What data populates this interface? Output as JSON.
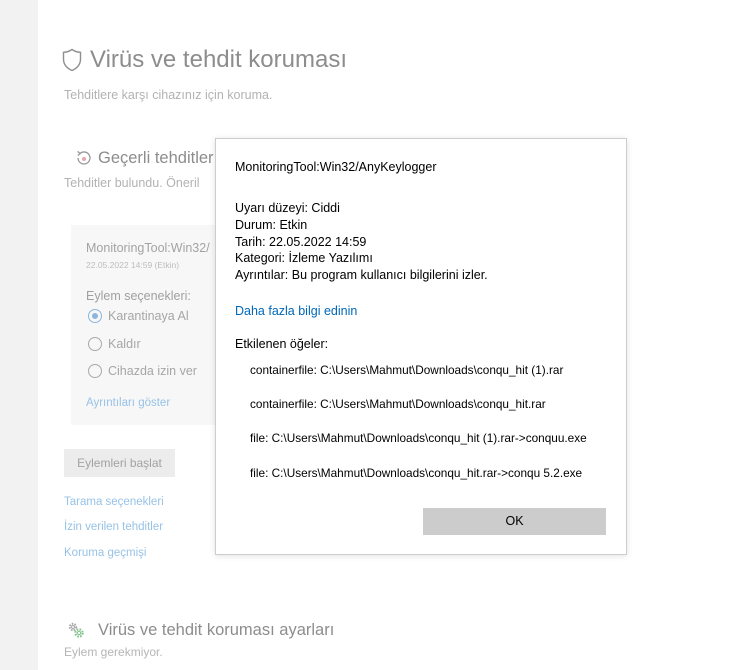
{
  "header": {
    "icon": "shield-icon",
    "title": "Virüs ve tehdit koruması",
    "subtitle": "Tehditlere karşı cihazınız için koruma."
  },
  "current_threats": {
    "icon": "threat-refresh-icon",
    "title": "Geçerli tehditler",
    "subtitle": "Tehditler bulundu. Öneril",
    "threat": {
      "name": "MonitoringTool:Win32/",
      "date": "22.05.2022 14:59 (Etkin)",
      "actions_label": "Eylem seçenekleri:",
      "options": [
        {
          "label": "Karantinaya Al",
          "selected": true
        },
        {
          "label": "Kaldır",
          "selected": false
        },
        {
          "label": "Cihazda izin ver",
          "selected": false
        }
      ],
      "details_link": "Ayrıntıları göster"
    },
    "start_button": "Eylemleri başlat",
    "links": [
      "Tarama seçenekleri",
      "İzin verilen tehditler",
      "Koruma geçmişi"
    ]
  },
  "settings": {
    "icon": "settings-gears-icon",
    "title": "Virüs ve tehdit koruması ayarları",
    "subtitle": "Eylem gerekmiyor."
  },
  "dialog": {
    "title": "MonitoringTool:Win32/AnyKeylogger",
    "details": [
      "Uyarı düzeyi: Ciddi",
      "Durum: Etkin",
      "Tarih: 22.05.2022 14:59",
      "Kategori: İzleme Yazılımı",
      "Ayrıntılar: Bu program kullanıcı bilgilerini izler."
    ],
    "more_info_link": "Daha fazla bilgi edinin",
    "affected_label": "Etkilenen öğeler:",
    "affected_items": [
      "containerfile: C:\\Users\\Mahmut\\Downloads\\conqu_hit (1).rar",
      "containerfile: C:\\Users\\Mahmut\\Downloads\\conqu_hit.rar",
      "file: C:\\Users\\Mahmut\\Downloads\\conqu_hit (1).rar->conquu.exe",
      "file: C:\\Users\\Mahmut\\Downloads\\conqu_hit.rar->conqu 5.2.exe"
    ],
    "ok_label": "OK"
  },
  "colors": {
    "dialog_link": "#0067b8",
    "faded_link": "#97c2e7",
    "ok_button_bg": "#cccccc",
    "radio_selected": "#8db5dc"
  }
}
